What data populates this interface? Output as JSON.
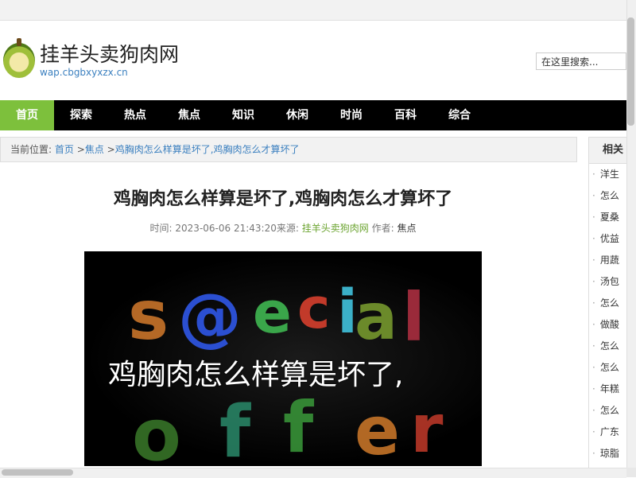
{
  "site": {
    "title": "挂羊头卖狗肉网",
    "url": "wap.cbgbxyxzx.cn",
    "search_value": "在这里搜索..."
  },
  "nav": {
    "items": [
      "首页",
      "探索",
      "热点",
      "焦点",
      "知识",
      "休闲",
      "时尚",
      "百科",
      "综合"
    ],
    "active_index": 0,
    "active_color": "#7dc03c"
  },
  "breadcrumb": {
    "prefix": "当前位置:",
    "home": "首页",
    "sep": ">",
    "category": "焦点",
    "current": "鸡胸肉怎么样算是坏了,鸡胸肉怎么才算坏了"
  },
  "article": {
    "title": "鸡胸肉怎么样算是坏了,鸡胸肉怎么才算坏了",
    "time_label": "时间:",
    "time": "2023-06-06 21:43:20",
    "source_label": "来源:",
    "source": "挂羊头卖狗肉网",
    "author_label": "作者:",
    "author": "焦点",
    "image_caption": "鸡胸肉怎么样算是坏了,"
  },
  "sidebar": {
    "heading": "相关",
    "items": [
      "洋生",
      "怎么",
      "夏桑",
      "优益",
      "用蔬",
      "汤包",
      "怎么",
      "做酸",
      "怎么",
      "怎么",
      "年糕",
      "怎么",
      "广东",
      "琼脂"
    ]
  }
}
